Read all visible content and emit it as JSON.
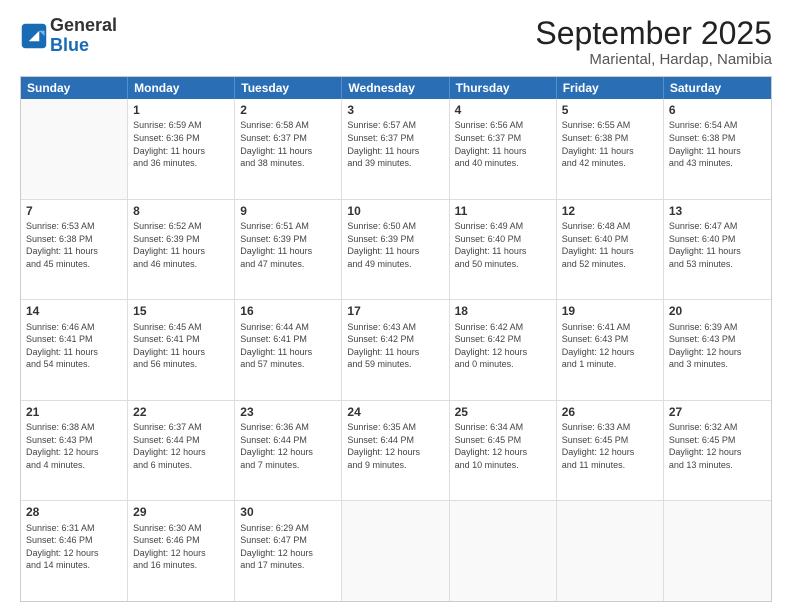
{
  "header": {
    "logo": {
      "general": "General",
      "blue": "Blue"
    },
    "title": "September 2025",
    "subtitle": "Mariental, Hardap, Namibia"
  },
  "weekdays": [
    "Sunday",
    "Monday",
    "Tuesday",
    "Wednesday",
    "Thursday",
    "Friday",
    "Saturday"
  ],
  "rows": [
    [
      {
        "day": "",
        "info": ""
      },
      {
        "day": "1",
        "info": "Sunrise: 6:59 AM\nSunset: 6:36 PM\nDaylight: 11 hours\nand 36 minutes."
      },
      {
        "day": "2",
        "info": "Sunrise: 6:58 AM\nSunset: 6:37 PM\nDaylight: 11 hours\nand 38 minutes."
      },
      {
        "day": "3",
        "info": "Sunrise: 6:57 AM\nSunset: 6:37 PM\nDaylight: 11 hours\nand 39 minutes."
      },
      {
        "day": "4",
        "info": "Sunrise: 6:56 AM\nSunset: 6:37 PM\nDaylight: 11 hours\nand 40 minutes."
      },
      {
        "day": "5",
        "info": "Sunrise: 6:55 AM\nSunset: 6:38 PM\nDaylight: 11 hours\nand 42 minutes."
      },
      {
        "day": "6",
        "info": "Sunrise: 6:54 AM\nSunset: 6:38 PM\nDaylight: 11 hours\nand 43 minutes."
      }
    ],
    [
      {
        "day": "7",
        "info": "Sunrise: 6:53 AM\nSunset: 6:38 PM\nDaylight: 11 hours\nand 45 minutes."
      },
      {
        "day": "8",
        "info": "Sunrise: 6:52 AM\nSunset: 6:39 PM\nDaylight: 11 hours\nand 46 minutes."
      },
      {
        "day": "9",
        "info": "Sunrise: 6:51 AM\nSunset: 6:39 PM\nDaylight: 11 hours\nand 47 minutes."
      },
      {
        "day": "10",
        "info": "Sunrise: 6:50 AM\nSunset: 6:39 PM\nDaylight: 11 hours\nand 49 minutes."
      },
      {
        "day": "11",
        "info": "Sunrise: 6:49 AM\nSunset: 6:40 PM\nDaylight: 11 hours\nand 50 minutes."
      },
      {
        "day": "12",
        "info": "Sunrise: 6:48 AM\nSunset: 6:40 PM\nDaylight: 11 hours\nand 52 minutes."
      },
      {
        "day": "13",
        "info": "Sunrise: 6:47 AM\nSunset: 6:40 PM\nDaylight: 11 hours\nand 53 minutes."
      }
    ],
    [
      {
        "day": "14",
        "info": "Sunrise: 6:46 AM\nSunset: 6:41 PM\nDaylight: 11 hours\nand 54 minutes."
      },
      {
        "day": "15",
        "info": "Sunrise: 6:45 AM\nSunset: 6:41 PM\nDaylight: 11 hours\nand 56 minutes."
      },
      {
        "day": "16",
        "info": "Sunrise: 6:44 AM\nSunset: 6:41 PM\nDaylight: 11 hours\nand 57 minutes."
      },
      {
        "day": "17",
        "info": "Sunrise: 6:43 AM\nSunset: 6:42 PM\nDaylight: 11 hours\nand 59 minutes."
      },
      {
        "day": "18",
        "info": "Sunrise: 6:42 AM\nSunset: 6:42 PM\nDaylight: 12 hours\nand 0 minutes."
      },
      {
        "day": "19",
        "info": "Sunrise: 6:41 AM\nSunset: 6:43 PM\nDaylight: 12 hours\nand 1 minute."
      },
      {
        "day": "20",
        "info": "Sunrise: 6:39 AM\nSunset: 6:43 PM\nDaylight: 12 hours\nand 3 minutes."
      }
    ],
    [
      {
        "day": "21",
        "info": "Sunrise: 6:38 AM\nSunset: 6:43 PM\nDaylight: 12 hours\nand 4 minutes."
      },
      {
        "day": "22",
        "info": "Sunrise: 6:37 AM\nSunset: 6:44 PM\nDaylight: 12 hours\nand 6 minutes."
      },
      {
        "day": "23",
        "info": "Sunrise: 6:36 AM\nSunset: 6:44 PM\nDaylight: 12 hours\nand 7 minutes."
      },
      {
        "day": "24",
        "info": "Sunrise: 6:35 AM\nSunset: 6:44 PM\nDaylight: 12 hours\nand 9 minutes."
      },
      {
        "day": "25",
        "info": "Sunrise: 6:34 AM\nSunset: 6:45 PM\nDaylight: 12 hours\nand 10 minutes."
      },
      {
        "day": "26",
        "info": "Sunrise: 6:33 AM\nSunset: 6:45 PM\nDaylight: 12 hours\nand 11 minutes."
      },
      {
        "day": "27",
        "info": "Sunrise: 6:32 AM\nSunset: 6:45 PM\nDaylight: 12 hours\nand 13 minutes."
      }
    ],
    [
      {
        "day": "28",
        "info": "Sunrise: 6:31 AM\nSunset: 6:46 PM\nDaylight: 12 hours\nand 14 minutes."
      },
      {
        "day": "29",
        "info": "Sunrise: 6:30 AM\nSunset: 6:46 PM\nDaylight: 12 hours\nand 16 minutes."
      },
      {
        "day": "30",
        "info": "Sunrise: 6:29 AM\nSunset: 6:47 PM\nDaylight: 12 hours\nand 17 minutes."
      },
      {
        "day": "",
        "info": ""
      },
      {
        "day": "",
        "info": ""
      },
      {
        "day": "",
        "info": ""
      },
      {
        "day": "",
        "info": ""
      }
    ]
  ]
}
